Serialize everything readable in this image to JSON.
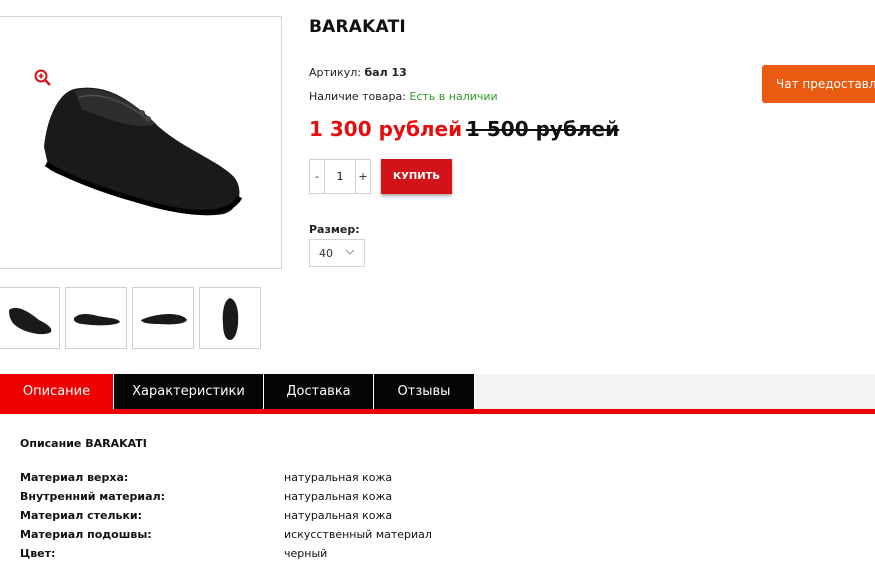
{
  "product": {
    "name": "BARAKATI",
    "sku_label": "Артикул:",
    "sku": "бал 13",
    "availability_label": "Наличие товара:",
    "availability": "Есть в наличии",
    "price_new": "1 300 рублей",
    "price_old": "1 500 рублей",
    "quantity": "1",
    "qty_minus": "-",
    "qty_plus": "+",
    "buy_label": "КУПИТЬ",
    "size_label": "Размер:",
    "size_value": "40"
  },
  "chat": {
    "label": "Чат предоставлен"
  },
  "gallery": {
    "main_image": "shoe-side-view",
    "thumbnails": [
      "shoe-front-angle",
      "shoe-side",
      "shoe-profile",
      "shoe-top-view"
    ]
  },
  "tabs": [
    {
      "label": "Описание",
      "active": true
    },
    {
      "label": "Характеристики",
      "active": false
    },
    {
      "label": "Доставка",
      "active": false
    },
    {
      "label": "Отзывы",
      "active": false
    }
  ],
  "description": {
    "title": "Описание BARAKATI",
    "specs": [
      {
        "key": "Материал верха:",
        "value": "натуральная кожа"
      },
      {
        "key": "Внутренний материал:",
        "value": "натуральная кожа"
      },
      {
        "key": "Материал стельки:",
        "value": "натуральная кожа"
      },
      {
        "key": "Материал подошвы:",
        "value": "искусственный материал"
      },
      {
        "key": "Цвет:",
        "value": "черный"
      }
    ]
  },
  "colors": {
    "accent_red": "#ee0000",
    "price_red": "#e60d0d",
    "buy_red": "#d2141a",
    "chat_orange": "#ea5a0f",
    "in_stock_green": "#2a9a2a",
    "tab_black": "#050505"
  }
}
